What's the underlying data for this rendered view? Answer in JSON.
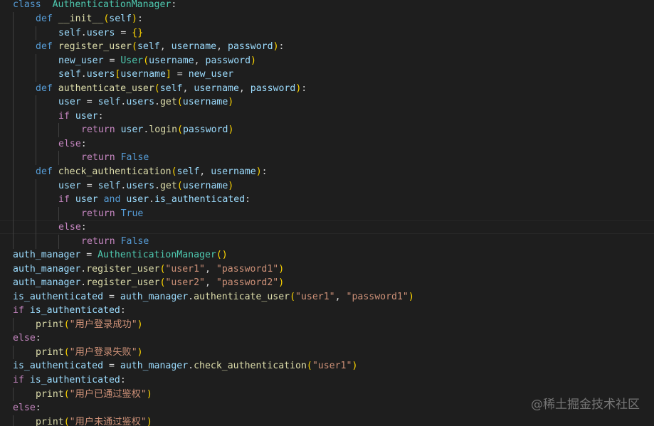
{
  "editor": {
    "language": "python",
    "theme": "Dark+",
    "colors": {
      "background": "#1e1e1e",
      "keyword": "#569cd6",
      "control": "#c586c0",
      "class": "#4ec9b0",
      "function": "#dcdcaa",
      "variable": "#9cdcfe",
      "string": "#ce9178",
      "text": "#d4d4d4",
      "bracket_1": "#ffd700",
      "bracket_2": "#da70d6",
      "bracket_3": "#179fff"
    }
  },
  "code": {
    "lines": [
      [
        [
          "kw",
          "class"
        ],
        [
          "",
          "  "
        ],
        [
          "cls",
          "AuthenticationManager"
        ],
        [
          "op",
          ":"
        ]
      ],
      [
        [
          "",
          ""
        ]
      ],
      [
        [
          "kw",
          "def"
        ],
        [
          "",
          " "
        ],
        [
          "fn",
          "__init__"
        ],
        [
          "p1",
          "("
        ],
        [
          "var",
          "self"
        ],
        [
          "p1",
          ")"
        ],
        [
          "op",
          ":"
        ]
      ],
      [
        [
          "var",
          "self"
        ],
        [
          "op",
          "."
        ],
        [
          "var",
          "users"
        ],
        [
          "op",
          " = "
        ],
        [
          "p1",
          "{}"
        ]
      ],
      [
        [
          "kw",
          "def"
        ],
        [
          "",
          " "
        ],
        [
          "fn",
          "register_user"
        ],
        [
          "p1",
          "("
        ],
        [
          "var",
          "self"
        ],
        [
          "op",
          ", "
        ],
        [
          "var",
          "username"
        ],
        [
          "op",
          ", "
        ],
        [
          "var",
          "password"
        ],
        [
          "p1",
          ")"
        ],
        [
          "op",
          ":"
        ]
      ],
      [
        [
          "var",
          "new_user"
        ],
        [
          "op",
          " = "
        ],
        [
          "cls",
          "User"
        ],
        [
          "p1",
          "("
        ],
        [
          "var",
          "username"
        ],
        [
          "op",
          ", "
        ],
        [
          "var",
          "password"
        ],
        [
          "p1",
          ")"
        ]
      ],
      [
        [
          "var",
          "self"
        ],
        [
          "op",
          "."
        ],
        [
          "var",
          "users"
        ],
        [
          "p1",
          "["
        ],
        [
          "var",
          "username"
        ],
        [
          "p1",
          "]"
        ],
        [
          "op",
          " = "
        ],
        [
          "var",
          "new_user"
        ]
      ],
      [
        [
          "kw",
          "def"
        ],
        [
          "",
          " "
        ],
        [
          "fn",
          "authenticate_user"
        ],
        [
          "p1",
          "("
        ],
        [
          "var",
          "self"
        ],
        [
          "op",
          ", "
        ],
        [
          "var",
          "username"
        ],
        [
          "op",
          ", "
        ],
        [
          "var",
          "password"
        ],
        [
          "p1",
          ")"
        ],
        [
          "op",
          ":"
        ]
      ],
      [
        [
          "var",
          "user"
        ],
        [
          "op",
          " = "
        ],
        [
          "var",
          "self"
        ],
        [
          "op",
          "."
        ],
        [
          "var",
          "users"
        ],
        [
          "op",
          "."
        ],
        [
          "fn",
          "get"
        ],
        [
          "p1",
          "("
        ],
        [
          "var",
          "username"
        ],
        [
          "p1",
          ")"
        ]
      ],
      [
        [
          "ctl",
          "if"
        ],
        [
          "",
          " "
        ],
        [
          "var",
          "user"
        ],
        [
          "op",
          ":"
        ]
      ],
      [
        [
          "ctl",
          "return"
        ],
        [
          "",
          " "
        ],
        [
          "var",
          "user"
        ],
        [
          "op",
          "."
        ],
        [
          "fn",
          "login"
        ],
        [
          "p1",
          "("
        ],
        [
          "var",
          "password"
        ],
        [
          "p1",
          ")"
        ]
      ],
      [
        [
          "ctl",
          "else"
        ],
        [
          "op",
          ":"
        ]
      ],
      [
        [
          "ctl",
          "return"
        ],
        [
          "",
          " "
        ],
        [
          "kw",
          "False"
        ]
      ],
      [
        [
          "kw",
          "def"
        ],
        [
          "",
          " "
        ],
        [
          "fn",
          "check_authentication"
        ],
        [
          "p1",
          "("
        ],
        [
          "var",
          "self"
        ],
        [
          "op",
          ", "
        ],
        [
          "var",
          "username"
        ],
        [
          "p1",
          ")"
        ],
        [
          "op",
          ":"
        ]
      ],
      [
        [
          "var",
          "user"
        ],
        [
          "op",
          " = "
        ],
        [
          "var",
          "self"
        ],
        [
          "op",
          "."
        ],
        [
          "var",
          "users"
        ],
        [
          "op",
          "."
        ],
        [
          "fn",
          "get"
        ],
        [
          "p1",
          "("
        ],
        [
          "var",
          "username"
        ],
        [
          "p1",
          ")"
        ]
      ],
      [
        [
          "ctl",
          "if"
        ],
        [
          "",
          " "
        ],
        [
          "var",
          "user"
        ],
        [
          "",
          " "
        ],
        [
          "kw",
          "and"
        ],
        [
          "",
          " "
        ],
        [
          "var",
          "user"
        ],
        [
          "op",
          "."
        ],
        [
          "var",
          "is_authenticated"
        ],
        [
          "op",
          ":"
        ]
      ],
      [
        [
          "ctl",
          "return"
        ],
        [
          "",
          " "
        ],
        [
          "kw",
          "True"
        ]
      ],
      [
        [
          "ctl",
          "else"
        ],
        [
          "op",
          ":"
        ]
      ],
      [
        [
          "ctl",
          "return"
        ],
        [
          "",
          " "
        ],
        [
          "kw",
          "False"
        ]
      ],
      [
        [
          "var",
          "auth_manager"
        ],
        [
          "op",
          " = "
        ],
        [
          "cls",
          "AuthenticationManager"
        ],
        [
          "p1",
          "()"
        ]
      ],
      [
        [
          "var",
          "auth_manager"
        ],
        [
          "op",
          "."
        ],
        [
          "fn",
          "register_user"
        ],
        [
          "p1",
          "("
        ],
        [
          "str",
          "\"user1\""
        ],
        [
          "op",
          ", "
        ],
        [
          "str",
          "\"password1\""
        ],
        [
          "p1",
          ")"
        ]
      ],
      [
        [
          "var",
          "auth_manager"
        ],
        [
          "op",
          "."
        ],
        [
          "fn",
          "register_user"
        ],
        [
          "p1",
          "("
        ],
        [
          "str",
          "\"user2\""
        ],
        [
          "op",
          ", "
        ],
        [
          "str",
          "\"password2\""
        ],
        [
          "p1",
          ")"
        ]
      ],
      [
        [
          "var",
          "is_authenticated"
        ],
        [
          "op",
          " = "
        ],
        [
          "var",
          "auth_manager"
        ],
        [
          "op",
          "."
        ],
        [
          "fn",
          "authenticate_user"
        ],
        [
          "p1",
          "("
        ],
        [
          "str",
          "\"user1\""
        ],
        [
          "op",
          ", "
        ],
        [
          "str",
          "\"password1\""
        ],
        [
          "p1",
          ")"
        ]
      ],
      [
        [
          "ctl",
          "if"
        ],
        [
          "",
          " "
        ],
        [
          "var",
          "is_authenticated"
        ],
        [
          "op",
          ":"
        ]
      ],
      [
        [
          "fn",
          "print"
        ],
        [
          "p1",
          "("
        ],
        [
          "str",
          "\"用户登录成功\""
        ],
        [
          "p1",
          ")"
        ]
      ],
      [
        [
          "ctl",
          "else"
        ],
        [
          "op",
          ":"
        ]
      ],
      [
        [
          "fn",
          "print"
        ],
        [
          "p1",
          "("
        ],
        [
          "str",
          "\"用户登录失败\""
        ],
        [
          "p1",
          ")"
        ]
      ],
      [
        [
          "var",
          "is_authenticated"
        ],
        [
          "op",
          " = "
        ],
        [
          "var",
          "auth_manager"
        ],
        [
          "op",
          "."
        ],
        [
          "fn",
          "check_authentication"
        ],
        [
          "p1",
          "("
        ],
        [
          "str",
          "\"user1\""
        ],
        [
          "p1",
          ")"
        ]
      ],
      [
        [
          "ctl",
          "if"
        ],
        [
          "",
          " "
        ],
        [
          "var",
          "is_authenticated"
        ],
        [
          "op",
          ":"
        ]
      ],
      [
        [
          "fn",
          "print"
        ],
        [
          "p1",
          "("
        ],
        [
          "str",
          "\"用户已通过鉴权\""
        ],
        [
          "p1",
          ")"
        ]
      ],
      [
        [
          "ctl",
          "else"
        ],
        [
          "op",
          ":"
        ]
      ],
      [
        [
          "fn",
          "print"
        ],
        [
          "p1",
          "("
        ],
        [
          "str",
          "\"用户未通过鉴权\""
        ],
        [
          "p1",
          ")"
        ]
      ]
    ]
  },
  "watermark": "@稀土掘金技术社区"
}
